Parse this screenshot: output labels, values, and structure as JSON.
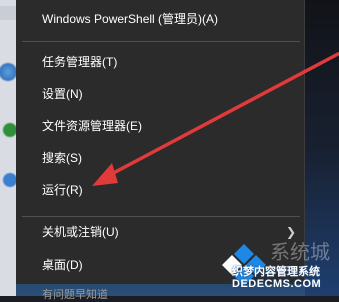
{
  "menu": {
    "items": [
      {
        "label": "Windows PowerShell (管理员)(A)"
      },
      {
        "label": "任务管理器(T)"
      },
      {
        "label": "设置(N)"
      },
      {
        "label": "文件资源管理器(E)"
      },
      {
        "label": "搜索(S)"
      },
      {
        "label": "运行(R)"
      },
      {
        "label": "关机或注销(U)"
      },
      {
        "label": "桌面(D)"
      }
    ],
    "partial_label": "有问题早知道"
  },
  "watermark": {
    "brand": "系统城",
    "line1": "织梦内容管理系统",
    "line2": "DEDECMS.COM"
  },
  "colors": {
    "menu_bg": "#2b2b2b",
    "arrow": "#e23a3a",
    "watermark_blue": "#1e88e5"
  },
  "icons": [
    "chevron-right-icon",
    "red-arrow-annotation",
    "windows-logo-icon"
  ]
}
